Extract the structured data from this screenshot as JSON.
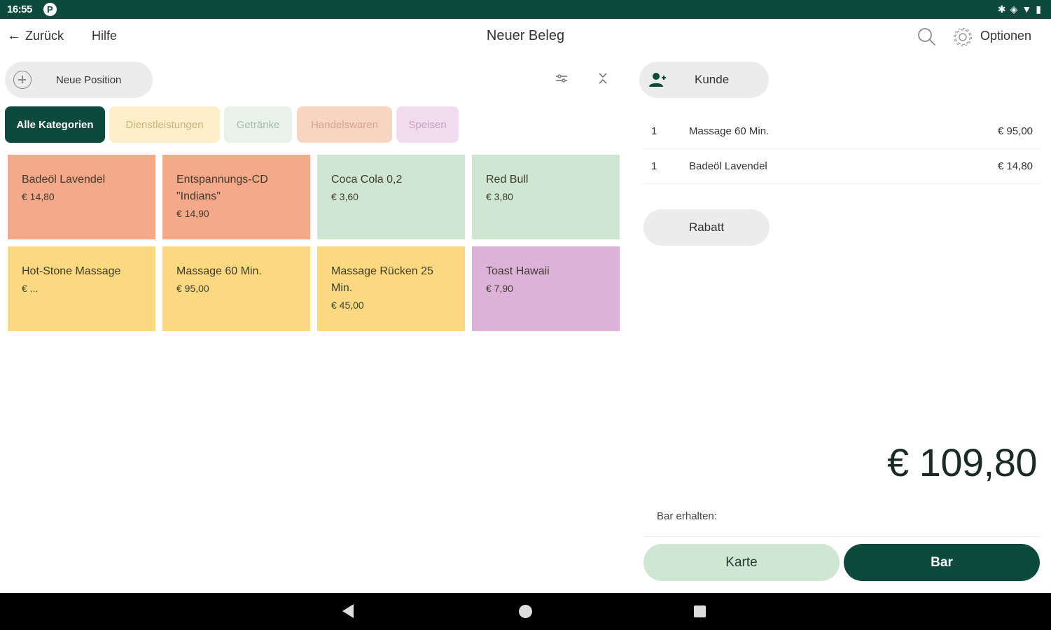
{
  "status_bar": {
    "time": "16:55",
    "icons": [
      "bluetooth-icon",
      "data-saver-icon",
      "wifi-icon",
      "battery-icon"
    ]
  },
  "app_bar": {
    "back_label": "Zurück",
    "help_label": "Hilfe",
    "title": "Neuer Beleg",
    "options_label": "Optionen"
  },
  "left_panel": {
    "new_position_label": "Neue Position",
    "categories": [
      {
        "label": "Alle Kategorien",
        "active": true
      },
      {
        "label": "Dienstleistungen"
      },
      {
        "label": "Getränke"
      },
      {
        "label": "Handelswaren"
      },
      {
        "label": "Speisen"
      }
    ],
    "products": [
      {
        "name": "Badeöl Lavendel",
        "price": "€ 14,80",
        "color": "#f5a88a"
      },
      {
        "name": "Entspannungs-CD \"Indians\"",
        "price": "€ 14,90",
        "color": "#f5a88a"
      },
      {
        "name": "Coca Cola 0,2",
        "price": "€ 3,60",
        "color": "#cfe6d2"
      },
      {
        "name": "Red Bull",
        "price": "€ 3,80",
        "color": "#cfe6d2"
      },
      {
        "name": "Hot-Stone Massage",
        "price": "€ ...",
        "color": "#fad982"
      },
      {
        "name": "Massage 60 Min.",
        "price": "€ 95,00",
        "color": "#fad982"
      },
      {
        "name": "Massage Rücken 25 Min.",
        "price": "€ 45,00",
        "color": "#fad982"
      },
      {
        "name": "Toast Hawaii",
        "price": "€ 7,90",
        "color": "#dcb2d9"
      }
    ]
  },
  "right_panel": {
    "customer_label": "Kunde",
    "line_items": [
      {
        "qty": "1",
        "name": "Massage 60 Min.",
        "amount": "€ 95,00"
      },
      {
        "qty": "1",
        "name": "Badeöl Lavendel",
        "amount": "€ 14,80"
      }
    ],
    "discount_label": "Rabatt",
    "total": "€ 109,80",
    "cash_received_label": "Bar erhalten:",
    "card_button_label": "Karte",
    "cash_button_label": "Bar"
  },
  "colors": {
    "brand": "#0d4a3c",
    "accent_light": "#cfe6d2"
  }
}
